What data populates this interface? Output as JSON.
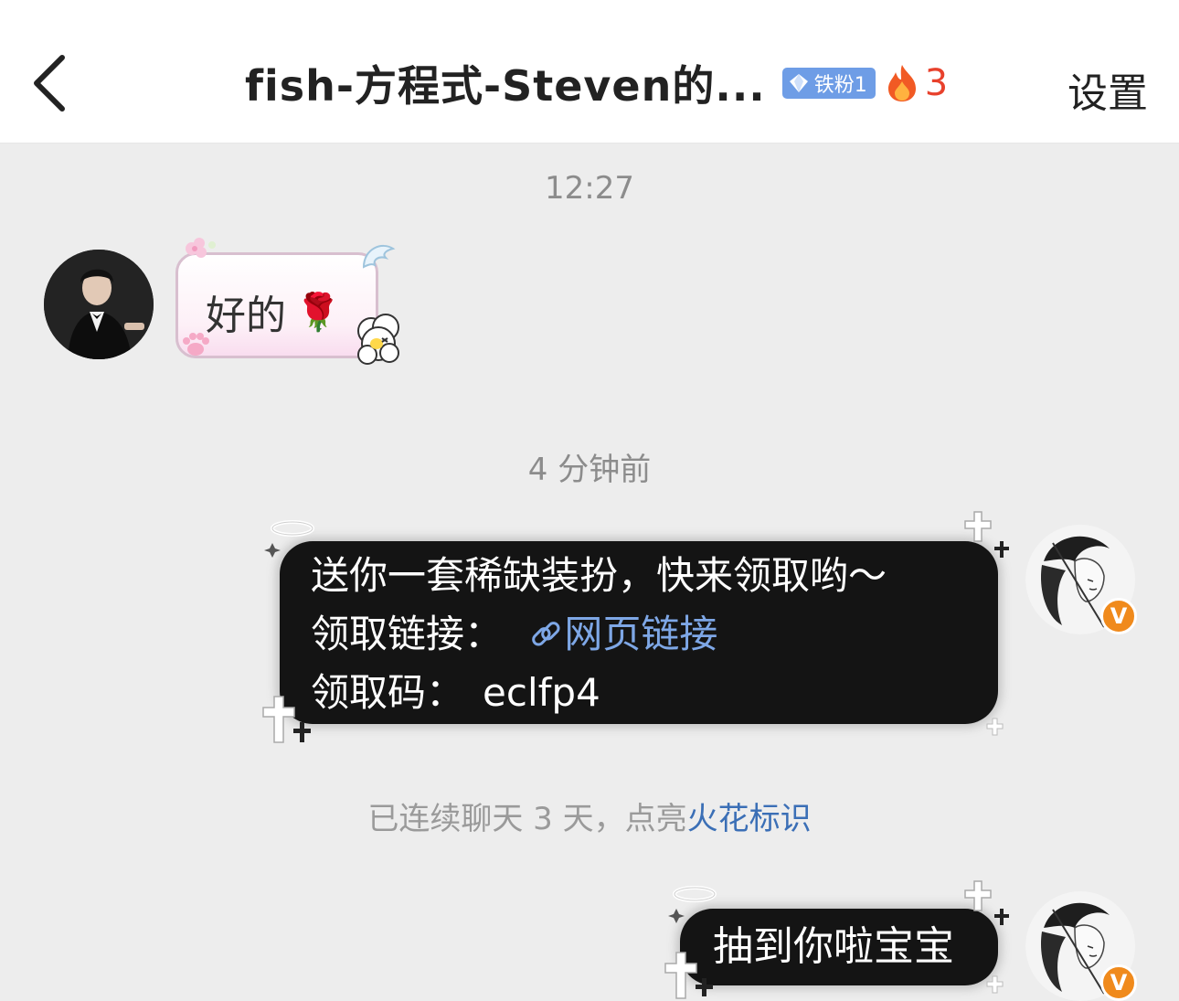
{
  "header": {
    "title": "fish-方程式-Steven的...",
    "fan_badge": "铁粉1",
    "fire_count": "3",
    "settings_label": "设置"
  },
  "messages": {
    "time_1": "12:27",
    "incoming_text": "好的",
    "incoming_emoji": "🌹",
    "time_2": "4 分钟前",
    "outgoing_1": {
      "line_1": "送你一套稀缺装扮，快来领取哟～",
      "link_prefix": "领取链接：",
      "link_text": "网页链接",
      "code_prefix": "领取码：",
      "code_value": "eclfp4"
    },
    "notice_text": "已连续聊天 3 天，点亮",
    "notice_link": "火花标识",
    "outgoing_2": "抽到你啦宝宝"
  },
  "colors": {
    "link_blue": "#3b6fb6",
    "fire_red": "#e8412c",
    "badge_blue": "#6e9de6",
    "verified_orange": "#f08a1c"
  },
  "icons": {
    "back": "chevron-left-icon",
    "badge": "diamond-icon",
    "fire": "fire-icon",
    "link": "link-icon",
    "verified": "verified-v-icon"
  }
}
